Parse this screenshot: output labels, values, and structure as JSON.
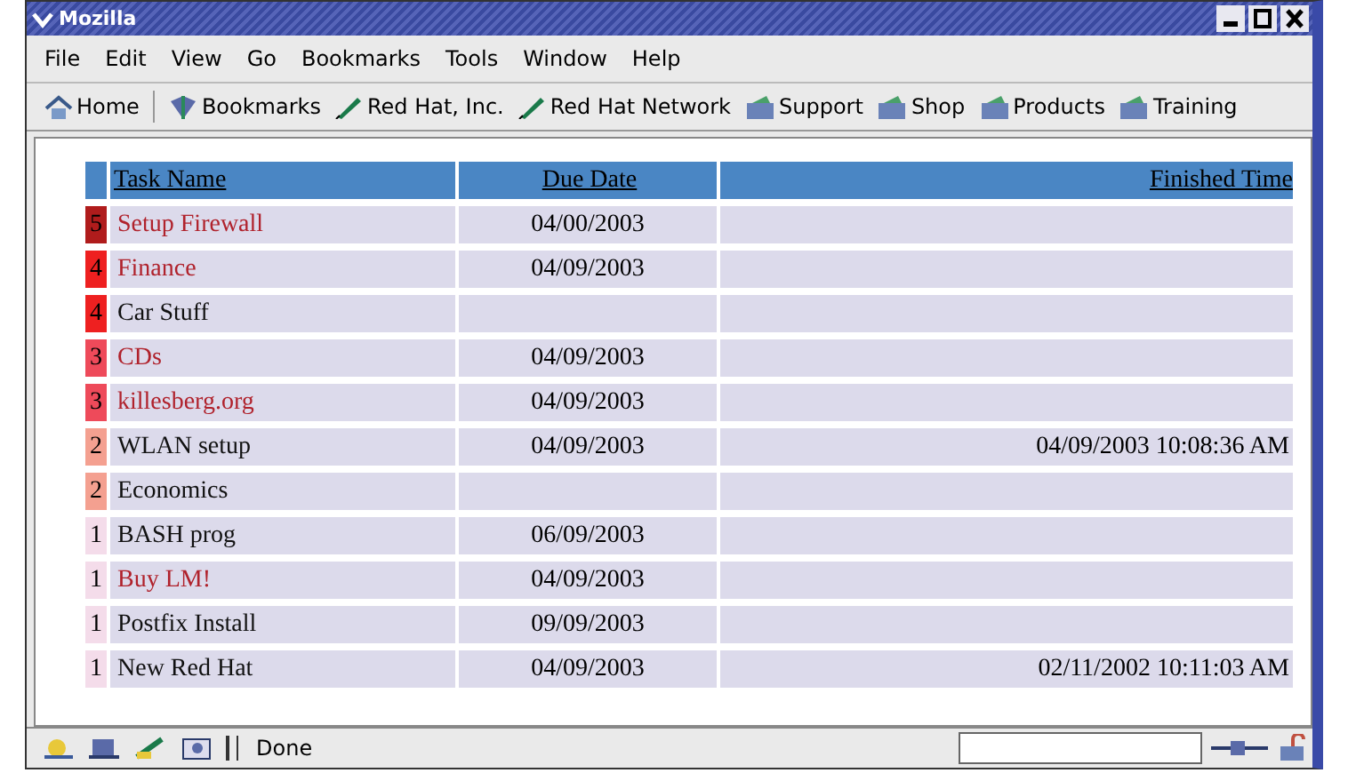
{
  "window": {
    "title": "Mozilla"
  },
  "menu": [
    "File",
    "Edit",
    "View",
    "Go",
    "Bookmarks",
    "Tools",
    "Window",
    "Help"
  ],
  "toolbar": [
    {
      "label": "Home",
      "kind": "home"
    },
    {
      "label": "Bookmarks",
      "kind": "bookmarks"
    },
    {
      "label": "Red Hat, Inc.",
      "kind": "link"
    },
    {
      "label": "Red Hat Network",
      "kind": "link"
    },
    {
      "label": "Support",
      "kind": "folder"
    },
    {
      "label": "Shop",
      "kind": "folder"
    },
    {
      "label": "Products",
      "kind": "folder"
    },
    {
      "label": "Training",
      "kind": "folder"
    }
  ],
  "table": {
    "columns": [
      "Task Name",
      "Due Date",
      "Finished Time"
    ],
    "rows": [
      {
        "priority": "5",
        "color": "#b01c1c",
        "name": "Setup Firewall",
        "highlighted": true,
        "due": "04/00/2003",
        "finished": ""
      },
      {
        "priority": "4",
        "color": "#ee2020",
        "name": "Finance",
        "highlighted": true,
        "due": "04/09/2003",
        "finished": ""
      },
      {
        "priority": "4",
        "color": "#ee2020",
        "name": "Car Stuff",
        "highlighted": false,
        "due": "",
        "finished": ""
      },
      {
        "priority": "3",
        "color": "#ee4a5a",
        "name": "CDs",
        "highlighted": true,
        "due": "04/09/2003",
        "finished": ""
      },
      {
        "priority": "3",
        "color": "#ee4a5a",
        "name": "killesberg.org",
        "highlighted": true,
        "due": "04/09/2003",
        "finished": ""
      },
      {
        "priority": "2",
        "color": "#f4a090",
        "name": "WLAN setup",
        "highlighted": false,
        "due": "04/09/2003",
        "finished": "04/09/2003 10:08:36 AM"
      },
      {
        "priority": "2",
        "color": "#f4a090",
        "name": "Economics",
        "highlighted": false,
        "due": "",
        "finished": ""
      },
      {
        "priority": "1",
        "color": "#f4dcea",
        "name": "BASH prog",
        "highlighted": false,
        "due": "06/09/2003",
        "finished": ""
      },
      {
        "priority": "1",
        "color": "#f4dcea",
        "name": "Buy LM!",
        "highlighted": true,
        "due": "04/09/2003",
        "finished": ""
      },
      {
        "priority": "1",
        "color": "#f4dcea",
        "name": "Postfix Install",
        "highlighted": false,
        "due": "09/09/2003",
        "finished": ""
      },
      {
        "priority": "1",
        "color": "#f4dcea",
        "name": "New Red Hat",
        "highlighted": false,
        "due": "04/09/2003",
        "finished": "02/11/2002 10:11:03 AM"
      }
    ]
  },
  "status_bar": {
    "text": "Done"
  }
}
